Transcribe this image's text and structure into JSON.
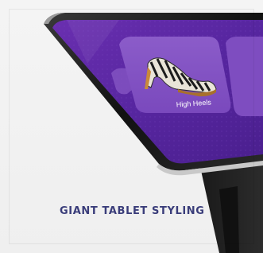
{
  "card": {
    "caption": "GIANT TABLET STYLING"
  },
  "kiosk_screen": {
    "tile_label": "High Heels"
  },
  "colors": {
    "caption_text": "#3a3d7a",
    "screen_purple": "#5a2a9e",
    "background": "#f2f2f2"
  }
}
